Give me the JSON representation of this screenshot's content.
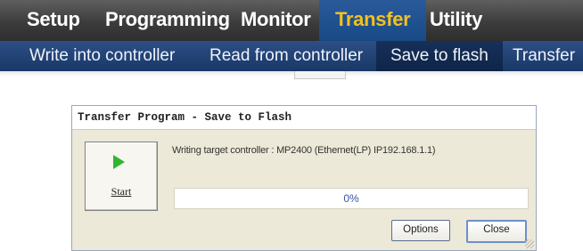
{
  "menu": {
    "items": [
      {
        "label": "Setup"
      },
      {
        "label": "Programming"
      },
      {
        "label": "Monitor"
      },
      {
        "label": "Transfer",
        "active": true
      },
      {
        "label": "Utility"
      }
    ]
  },
  "toolbar": {
    "items": [
      {
        "label": "Write into controller"
      },
      {
        "label": "Read from controller"
      },
      {
        "label": "Save to flash",
        "active": true
      },
      {
        "label": "Transfer"
      }
    ]
  },
  "dialog": {
    "title": "Transfer Program - Save to Flash",
    "start_button": {
      "label": "Start",
      "icon": "play-icon"
    },
    "target_info": "Writing target controller : MP2400    (Ethernet(LP) IP192.168.1.1)",
    "progress": {
      "value": 0,
      "label": "0%"
    },
    "options_button": "Options",
    "close_button": "Close"
  },
  "colors": {
    "menu_active_text": "#f3c020",
    "menu_active_bg": "#184a86",
    "toolbar_bg": "#1e3d6e",
    "play_icon": "#31b531"
  }
}
